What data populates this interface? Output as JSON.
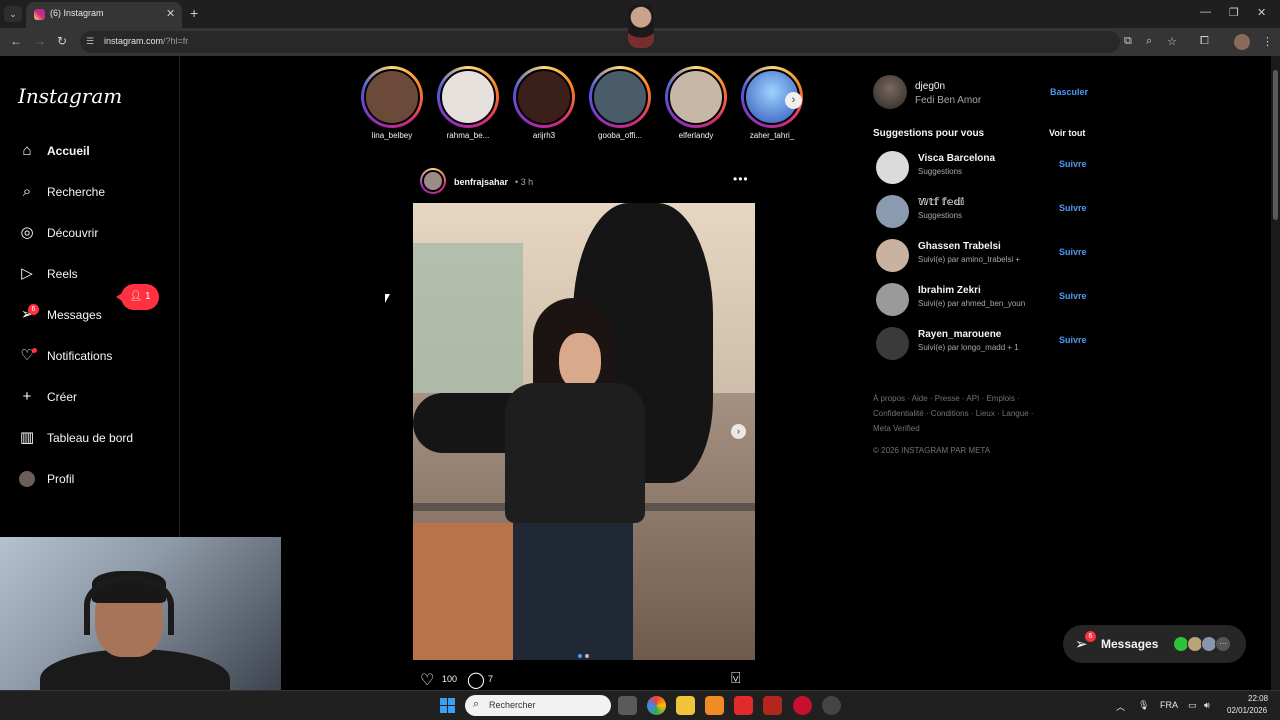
{
  "browser": {
    "tab_title": "(6) Instagram",
    "url_host": "instagram.com",
    "url_path": "/?hl=fr"
  },
  "sidebar": {
    "logo": "Instagram",
    "items": [
      {
        "label": "Accueil",
        "icon": "home-icon"
      },
      {
        "label": "Recherche",
        "icon": "search-icon"
      },
      {
        "label": "Découvrir",
        "icon": "compass-icon"
      },
      {
        "label": "Reels",
        "icon": "reels-icon"
      },
      {
        "label": "Messages",
        "icon": "messenger-icon",
        "badge": "6"
      },
      {
        "label": "Notifications",
        "icon": "heart-icon"
      },
      {
        "label": "Créer",
        "icon": "plus-icon"
      },
      {
        "label": "Tableau de bord",
        "icon": "dashboard-icon"
      },
      {
        "label": "Profil",
        "icon": "profile-avatar"
      }
    ],
    "notif_pill": "1"
  },
  "stories": [
    {
      "name": "lina_belbey",
      "color": "#6b4a3a"
    },
    {
      "name": "rahma_be...",
      "color": "#e6e1dc"
    },
    {
      "name": "arijrh3",
      "color": "#3a1f1a"
    },
    {
      "name": "gooba_offi...",
      "color": "#4a5b6a"
    },
    {
      "name": "elferlandy",
      "color": "#c7b7a6"
    },
    {
      "name": "zaher_tahri_",
      "color": "#3a6ed6"
    }
  ],
  "post": {
    "username": "benfrajsahar",
    "time": "• 3 h",
    "likes": "100",
    "comments": "7"
  },
  "right": {
    "me_username": "djeg0n",
    "me_fullname": "Fedi Ben Amor",
    "switch": "Basculer",
    "suggestions_title": "Suggestions pour vous",
    "see_all": "Voir tout",
    "follow": "Suivre",
    "suggestions": [
      {
        "name": "Visca Barcelona",
        "sub": "Suggestions"
      },
      {
        "name": "𝕎𝕥𝕗 𝕗𝕖𝕕𝕚",
        "sub": "Suggestions"
      },
      {
        "name": "Ghassen Trabelsi",
        "sub": "Suivi(e) par amino_trabelsi +"
      },
      {
        "name": "Ibrahim Zekri",
        "sub": "Suivi(e) par ahmed_ben_youn"
      },
      {
        "name": "Rayen_marouene",
        "sub": "Suivi(e) par longo_madd + 1"
      }
    ],
    "footer_line1": "À propos · Aide · Presse · API · Emplois ·",
    "footer_line2": "Confidentialité · Conditions · Lieux · Langue ·",
    "footer_line3": "Meta Verified",
    "copyright": "© 2026 INSTAGRAM PAR META"
  },
  "messages_float": {
    "label": "Messages",
    "badge": "6"
  },
  "taskbar": {
    "search_placeholder": "Rechercher",
    "lang": "FRA",
    "time": "22:08",
    "date": "02/01/2026"
  }
}
